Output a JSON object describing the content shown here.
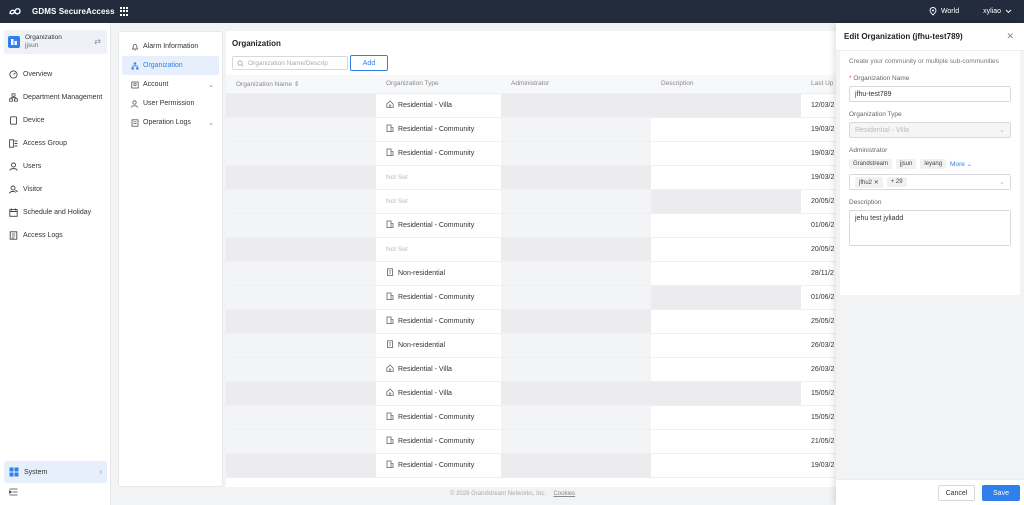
{
  "topbar": {
    "app_title": "GDMS SecureAccess",
    "region": "World",
    "user": "xyliao"
  },
  "sidebar": {
    "org_label": "Organization",
    "org_name": "jjsun",
    "items": [
      {
        "label": "Overview",
        "icon": "overview-icon"
      },
      {
        "label": "Department Management",
        "icon": "department-icon"
      },
      {
        "label": "Device",
        "icon": "device-icon"
      },
      {
        "label": "Access Group",
        "icon": "access-group-icon"
      },
      {
        "label": "Users",
        "icon": "users-icon"
      },
      {
        "label": "Visitor",
        "icon": "visitor-icon"
      },
      {
        "label": "Schedule and Holiday",
        "icon": "calendar-icon"
      },
      {
        "label": "Access Logs",
        "icon": "logs-icon"
      }
    ],
    "system_label": "System"
  },
  "subnav": {
    "items": [
      {
        "label": "Alarm Information",
        "icon": "bell-icon"
      },
      {
        "label": "Organization",
        "icon": "org-tree-icon",
        "active": true
      },
      {
        "label": "Account",
        "icon": "account-icon",
        "expandable": true
      },
      {
        "label": "User Permission",
        "icon": "user-permission-icon"
      },
      {
        "label": "Operation Logs",
        "icon": "operation-logs-icon",
        "expandable": true
      }
    ]
  },
  "main": {
    "title": "Organization",
    "search_placeholder": "Organization Name/Descrip",
    "add_label": "Add",
    "columns": [
      "Organization Name",
      "Organization Type",
      "Administrator",
      "Description",
      "Last Up"
    ],
    "rows": [
      {
        "type": "Residential - Villa",
        "date": "12/03/2"
      },
      {
        "type": "Residential - Community",
        "date": "19/03/2"
      },
      {
        "type": "Residential - Community",
        "date": "19/03/2"
      },
      {
        "type": "Not Set",
        "date": "19/03/2"
      },
      {
        "type": "Not Set",
        "date": "20/05/2"
      },
      {
        "type": "Residential - Community",
        "date": "01/06/2"
      },
      {
        "type": "Not Set",
        "date": "20/05/2"
      },
      {
        "type": "Non-residential",
        "date": "28/11/2"
      },
      {
        "type": "Residential - Community",
        "date": "01/06/2"
      },
      {
        "type": "Residential - Community",
        "date": "25/05/2"
      },
      {
        "type": "Non-residential",
        "date": "26/03/2"
      },
      {
        "type": "Residential - Villa",
        "date": "26/03/2"
      },
      {
        "type": "Residential - Villa",
        "date": "15/05/2"
      },
      {
        "type": "Residential - Community",
        "date": "15/05/2"
      },
      {
        "type": "Residential - Community",
        "date": "21/05/2"
      },
      {
        "type": "Residential - Community",
        "date": "19/03/2"
      }
    ]
  },
  "footer": {
    "copyright": "© 2026 Grandstream Networks, Inc.",
    "cookies": "Cookies"
  },
  "drawer": {
    "title": "Edit Organization (jfhu-test789)",
    "description": "Create your community or multiple sub-communities",
    "name_label": "Organization Name",
    "name_value": "jfhu-test789",
    "type_label": "Organization Type",
    "type_value": "Residential - Villa",
    "admin_label": "Administrator",
    "admin_tags": [
      "Grandstream",
      "jjsun",
      "leyang"
    ],
    "more_label": "More",
    "selected_admin": "jfhu2",
    "selected_more": "+ 29",
    "desc_label": "Description",
    "desc_value": "jehu test jyliadd",
    "cancel_label": "Cancel",
    "save_label": "Save"
  }
}
